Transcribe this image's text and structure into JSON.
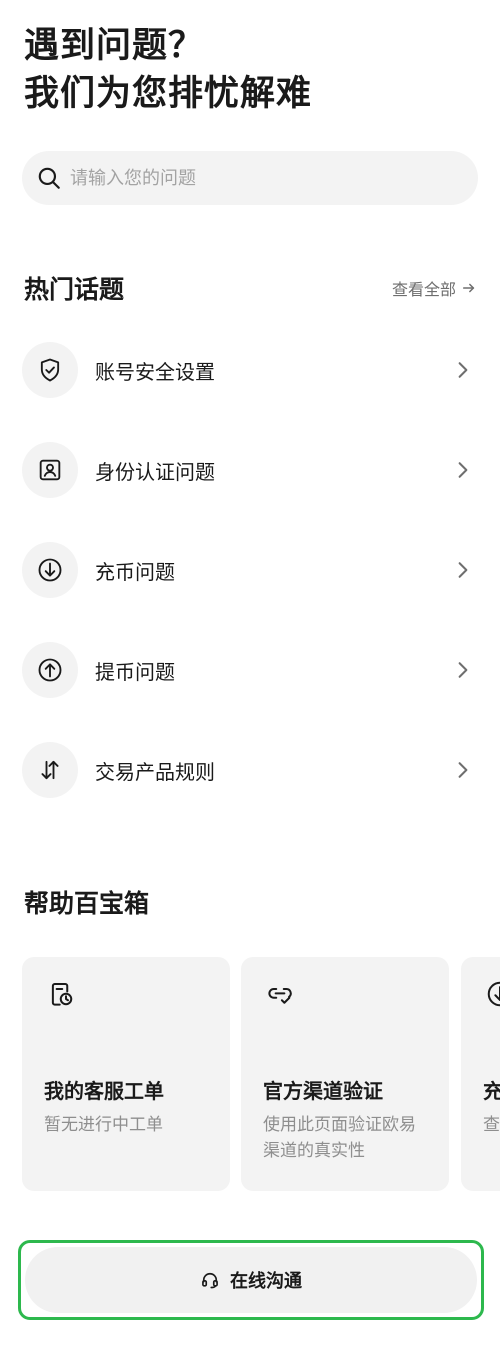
{
  "header": {
    "line1": "遇到问题？",
    "line2": "我们为您排忧解难"
  },
  "search": {
    "placeholder": "请输入您的问题",
    "value": ""
  },
  "hot_topics": {
    "title": "热门话题",
    "view_all": "查看全部",
    "items": [
      {
        "label": "账号安全设置",
        "icon": "shield-check-icon"
      },
      {
        "label": "身份认证问题",
        "icon": "id-card-icon"
      },
      {
        "label": "充币问题",
        "icon": "deposit-arrow-down-icon"
      },
      {
        "label": "提币问题",
        "icon": "withdraw-arrow-up-icon"
      },
      {
        "label": "交易产品规则",
        "icon": "swap-arrows-icon"
      }
    ]
  },
  "toolbox": {
    "title": "帮助百宝箱",
    "cards": [
      {
        "title": "我的客服工单",
        "desc": "暂无进行中工单",
        "icon": "ticket-clock-icon"
      },
      {
        "title": "官方渠道验证",
        "desc": "使用此页面验证欧易渠道的真实性",
        "icon": "link-check-icon"
      },
      {
        "title": "充",
        "desc": "查",
        "icon": "deposit-arrow-down-icon"
      }
    ]
  },
  "footer": {
    "chat_label": "在线沟通",
    "icon": "headset-icon",
    "highlight_color": "#2db84d"
  },
  "colors": {
    "text_primary": "#1a1a1a",
    "text_secondary": "#8e8e8e",
    "surface": "#f3f3f3"
  }
}
